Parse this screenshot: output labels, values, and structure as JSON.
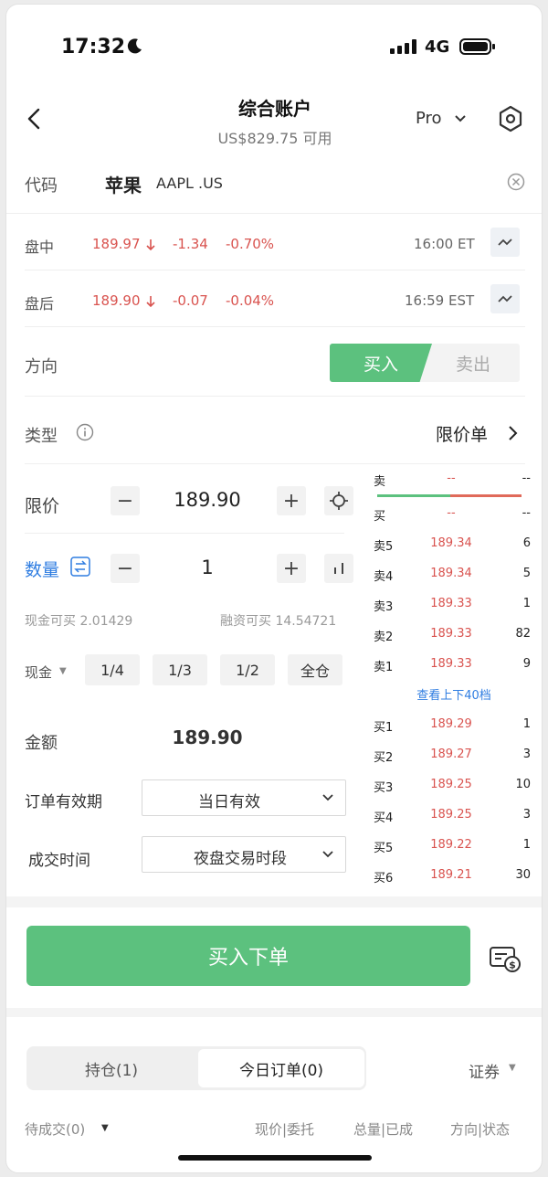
{
  "status": {
    "time": "17:32",
    "network": "4G"
  },
  "header": {
    "title": "综合账户",
    "subtitle": "US$829.75 可用",
    "mode": "Pro"
  },
  "code": {
    "label": "代码",
    "name": "苹果",
    "ticker": "AAPL .US"
  },
  "quotes": [
    {
      "label": "盘中",
      "price": "189.97",
      "change": "-1.34",
      "pct": "-0.70%",
      "time": "16:00 ET"
    },
    {
      "label": "盘后",
      "price": "189.90",
      "change": "-0.07",
      "pct": "-0.04%",
      "time": "16:59 EST"
    }
  ],
  "direction": {
    "label": "方向",
    "buy": "买入",
    "sell": "卖出"
  },
  "order_type": {
    "label": "类型",
    "value": "限价单"
  },
  "limit": {
    "label": "限价",
    "value": "189.90",
    "minus": "−",
    "plus": "+"
  },
  "quantity": {
    "label": "数量",
    "value": "1",
    "minus": "−",
    "plus": "+"
  },
  "buying_power": {
    "cash": "现金可买 2.01429",
    "margin": "融资可买 14.54721"
  },
  "fractions": {
    "label": "现金",
    "items": [
      "1/4",
      "1/3",
      "1/2",
      "全仓"
    ]
  },
  "amount": {
    "label": "金额",
    "value": "189.90"
  },
  "validity": {
    "label": "订单有效期",
    "value": "当日有效"
  },
  "session": {
    "label": "成交时间",
    "value": "夜盘交易时段"
  },
  "orderbook": {
    "top": [
      {
        "label": "卖",
        "price": "--",
        "qty": "--"
      },
      {
        "label": "买",
        "price": "--",
        "qty": "--"
      }
    ],
    "asks": [
      {
        "label": "卖5",
        "price": "189.34",
        "qty": "6"
      },
      {
        "label": "卖4",
        "price": "189.34",
        "qty": "5"
      },
      {
        "label": "卖3",
        "price": "189.33",
        "qty": "1"
      },
      {
        "label": "卖2",
        "price": "189.33",
        "qty": "82"
      },
      {
        "label": "卖1",
        "price": "189.33",
        "qty": "9"
      }
    ],
    "more": "查看上下40档",
    "bids": [
      {
        "label": "买1",
        "price": "189.29",
        "qty": "1"
      },
      {
        "label": "买2",
        "price": "189.27",
        "qty": "3"
      },
      {
        "label": "买3",
        "price": "189.25",
        "qty": "10"
      },
      {
        "label": "买4",
        "price": "189.25",
        "qty": "3"
      },
      {
        "label": "买5",
        "price": "189.22",
        "qty": "1"
      },
      {
        "label": "买6",
        "price": "189.21",
        "qty": "30"
      }
    ]
  },
  "submit": {
    "label": "买入下单"
  },
  "tabs": {
    "positions": "持仓(1)",
    "orders": "今日订单(0)",
    "filter": "证券"
  },
  "footer": {
    "pending": "待成交(0)",
    "col1": "现价|委托",
    "col2": "总量|已成",
    "col3": "方向|状态"
  },
  "colors": {
    "buy_green": "#5cc17e",
    "down_red": "#d9534f",
    "link_blue": "#2f7de1"
  }
}
